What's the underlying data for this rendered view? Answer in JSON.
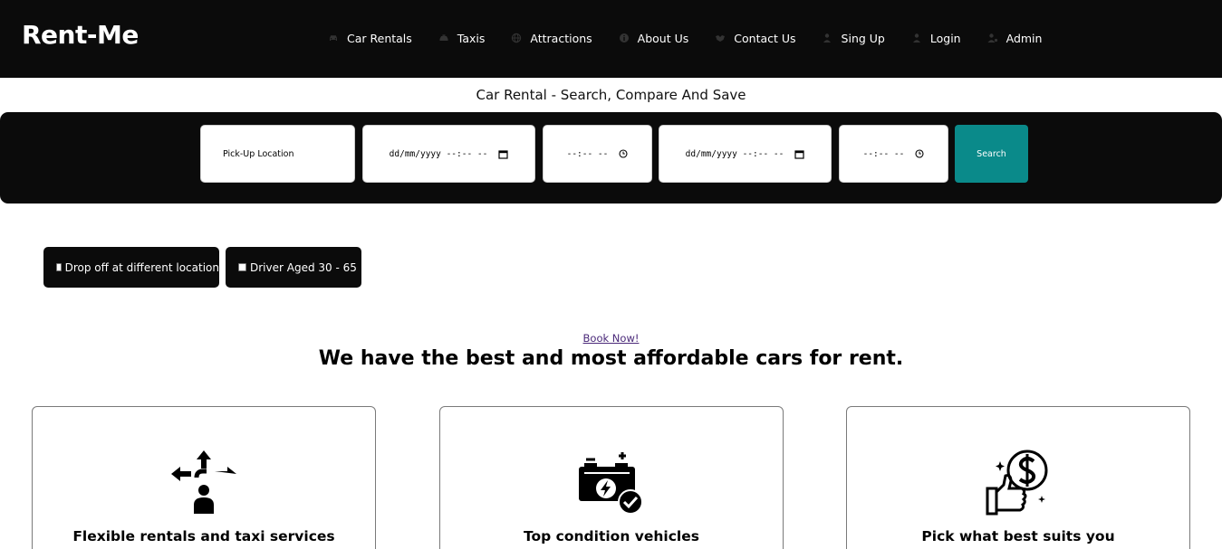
{
  "brand": "Rent-Me",
  "nav": [
    {
      "label": "Car Rentals",
      "icon": "car-icon"
    },
    {
      "label": "Taxis",
      "icon": "taxi-icon"
    },
    {
      "label": "Attractions",
      "icon": "globe-icon"
    },
    {
      "label": "About Us",
      "icon": "info-icon"
    },
    {
      "label": "Contact Us",
      "icon": "handshake-icon"
    },
    {
      "label": "Sing Up",
      "icon": "user-plus-icon"
    },
    {
      "label": "Login",
      "icon": "user-icon"
    },
    {
      "label": "Admin",
      "icon": "user-gear-icon"
    }
  ],
  "subtitle": "Car Rental - Search, Compare And Save",
  "search": {
    "pickup_placeholder": "Pick-Up Location",
    "pickup_date": "dd/mm/yyyy --:-- --",
    "pickup_time": "--:-- --",
    "dropoff_date": "dd/mm/yyyy --:-- --",
    "dropoff_time": "--:-- --",
    "button_label": "Search"
  },
  "options": {
    "dropoff_label": "Drop off at different location",
    "driver_age_label": "Driver Aged 30 - 65"
  },
  "hero": {
    "link_label": "Book Now!",
    "headline": "We have the best and most affordable cars for rent."
  },
  "features": [
    {
      "title": "Flexible rentals and taxi services",
      "icon": "directions-person-icon"
    },
    {
      "title": "Top condition vehicles",
      "icon": "battery-check-icon"
    },
    {
      "title": "Pick what best suits you",
      "icon": "thumbs-up-dollar-icon"
    }
  ],
  "colors": {
    "dark": "#0b0b0b",
    "accent": "#0a8a8a",
    "link": "#4b2a7a"
  }
}
